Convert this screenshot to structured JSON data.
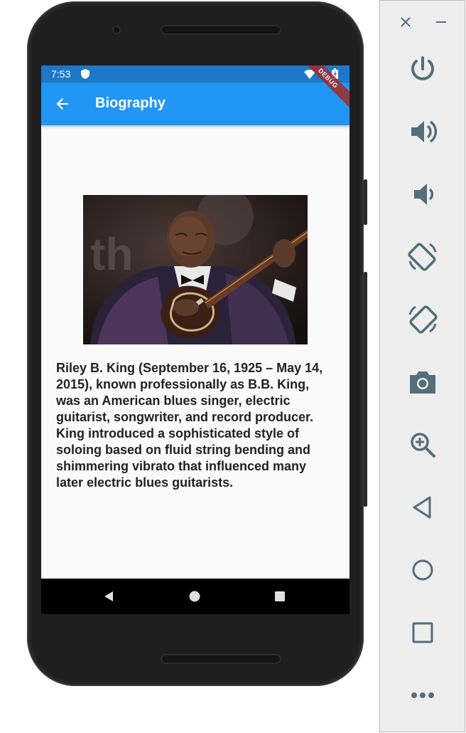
{
  "status_bar": {
    "time": "7:53"
  },
  "app_bar": {
    "title": "Biography"
  },
  "debug_banner": "DEBUG",
  "bio": {
    "text": "Riley B. King (September 16, 1925 – May 14, 2015), known professionally as B.B. King, was an American blues singer, electric guitarist, songwriter, and record producer. King introduced a sophisticated style of soloing based on fluid string bending and shimmering vibrato that influenced many later electric blues guitarists."
  },
  "nav_bar": {
    "buttons": [
      "back",
      "home",
      "recents"
    ]
  },
  "emulator_sidebar": {
    "top_controls": [
      "close-icon",
      "minimize-icon"
    ],
    "buttons": [
      "power-icon",
      "volume-up-icon",
      "volume-down-icon",
      "rotate-left-icon",
      "rotate-right-icon",
      "camera-icon",
      "zoom-icon",
      "back-icon",
      "home-icon",
      "overview-icon",
      "more-icon"
    ]
  },
  "colors": {
    "app_bar": "#2196f3",
    "status_bar": "#1e78c8",
    "screen_bg": "#fafafa",
    "sidebar_icon": "#546e7a"
  }
}
